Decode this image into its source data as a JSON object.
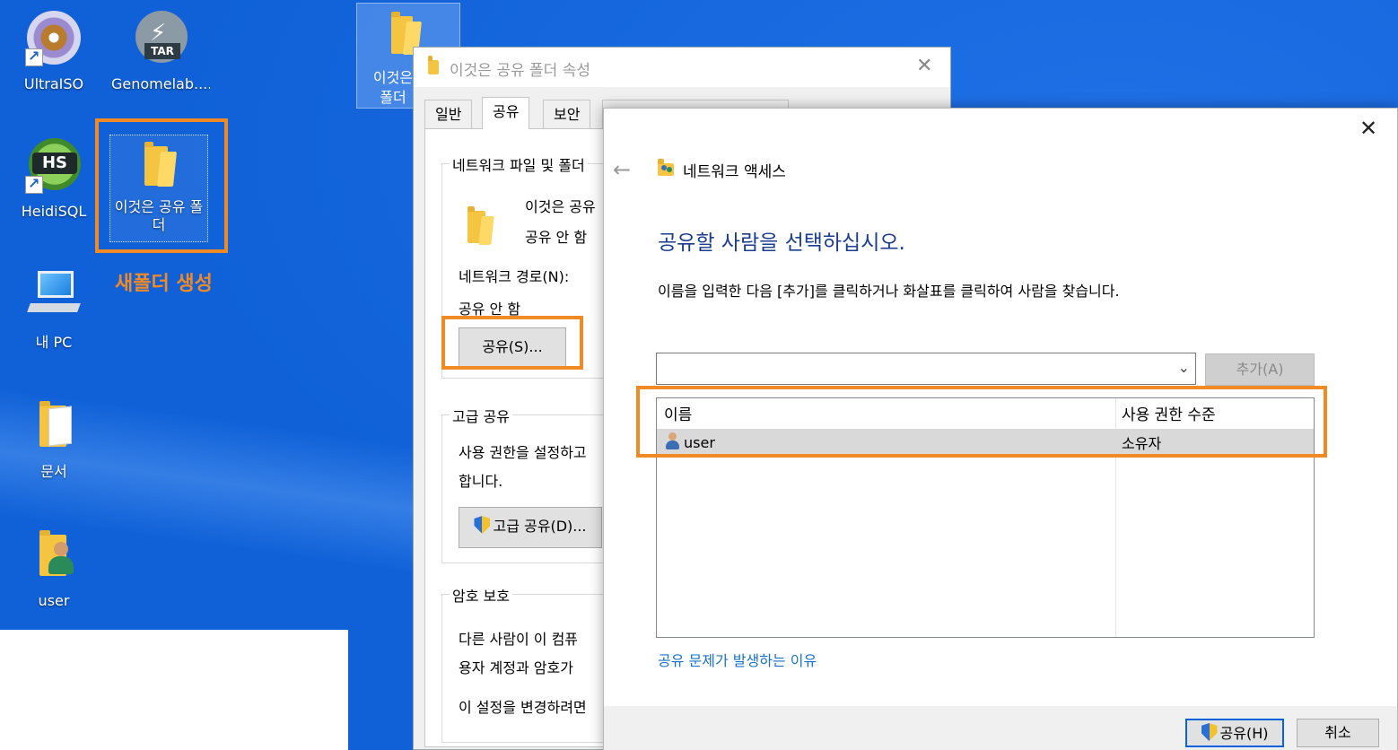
{
  "desktop": {
    "icons": [
      {
        "label": "UltraISO"
      },
      {
        "label": "Genomelab...."
      },
      {
        "label": "HeidiSQL"
      },
      {
        "label": "이것은 공유 폴더"
      },
      {
        "label": "내 PC"
      },
      {
        "label": "문서"
      },
      {
        "label": "user"
      }
    ],
    "top_folder_label": "이것은\n폴더",
    "annotation": "새폴더 생성"
  },
  "icons": {
    "ultraiso": "disc-icon",
    "genomelab": "tar-archive-icon",
    "heidisql": "hs-db-icon",
    "folder": "folder-icon",
    "pc": "monitor-icon",
    "docs": "documents-folder-icon",
    "user": "user-folder-icon",
    "tar": "TAR",
    "hs": "HS"
  },
  "properties": {
    "title": "이것은 공유 폴더 속성",
    "close": "✕",
    "tabs": [
      "일반",
      "공유",
      "보안"
    ],
    "network_group_title": "네트워크 파일 및 폴더",
    "folder_name": "이것은 공유",
    "share_state": "공유 안 함",
    "network_path_label": "네트워크 경로(N):",
    "network_path_value": "공유 안 함",
    "share_button": "공유(S)...",
    "advanced_group_title": "고급 공유",
    "advanced_text_1": "사용 권한을 설정하고",
    "advanced_text_2": "합니다.",
    "advanced_button": "고급 공유(D)...",
    "password_group_title": "암호 보호",
    "password_text_1": "다른 사람이 이 컴퓨",
    "password_text_2": "용자 계정과 암호가",
    "password_text_3": "이 설정을 변경하려면"
  },
  "network_access": {
    "close": "✕",
    "back": "←",
    "title": "네트워크 액세스",
    "heading": "공유할 사람을 선택하십시오.",
    "instruction": "이름을 입력한 다음 [추가]를 클릭하거나 화살표를 클릭하여 사람을 찾습니다.",
    "combo_value": "",
    "add_button": "추가(A)",
    "columns": [
      "이름",
      "사용 권한 수준"
    ],
    "rows": [
      {
        "name": "user",
        "permission": "소유자"
      }
    ],
    "help_link": "공유 문제가 발생하는 이유",
    "share_button": "공유(H)",
    "cancel_button": "취소"
  },
  "colors": {
    "desktop": "#1061d8",
    "highlight": "#f08a24",
    "heading": "#1a3d8f",
    "link": "#1a73c8"
  }
}
